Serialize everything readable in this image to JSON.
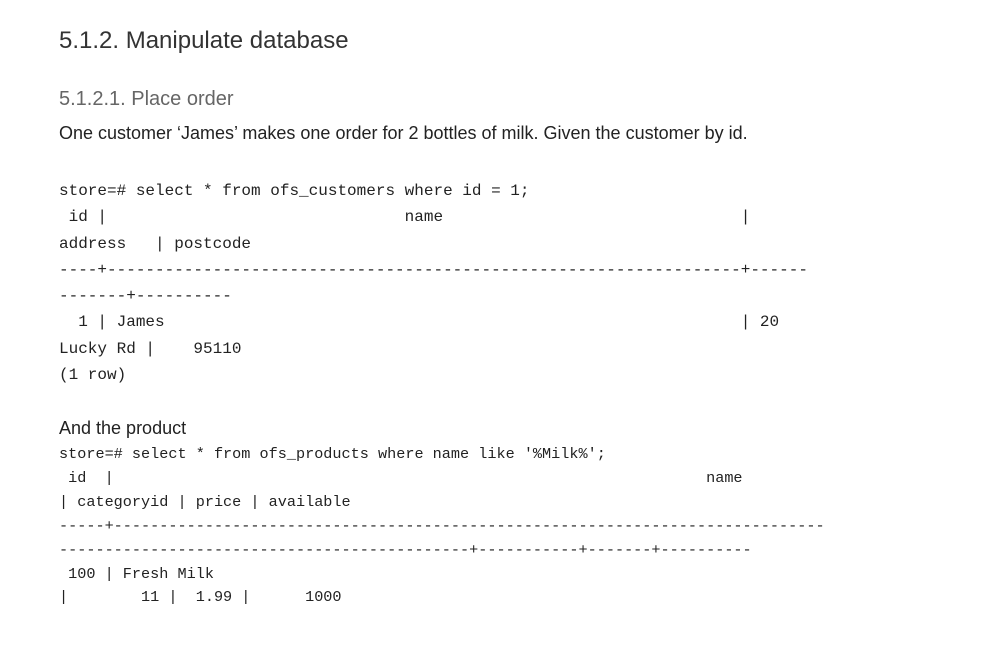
{
  "section_heading": "5.1.2. Manipulate database",
  "subsection_heading": "5.1.2.1. Place order",
  "intro_paragraph": "One customer ‘James’ makes one order for 2 bottles of milk. Given the customer by id.",
  "customer_query": {
    "lines": [
      "store=# select * from ofs_customers where id = 1;",
      " id |                               name                               |",
      "address   | postcode",
      "----+------------------------------------------------------------------+------",
      "-------+----------",
      "  1 | James                                                            | 20",
      "Lucky Rd |    95110",
      "(1 row)"
    ]
  },
  "product_paragraph": "And the product",
  "product_query": {
    "lines": [
      "store=# select * from ofs_products where name like '%Milk%';",
      " id  |                                                                 name",
      "| categoryid | price | available",
      "-----+------------------------------------------------------------------------------",
      "---------------------------------------------+-----------+-------+----------",
      " 100 | Fresh Milk",
      "|        11 |  1.99 |      1000"
    ]
  }
}
